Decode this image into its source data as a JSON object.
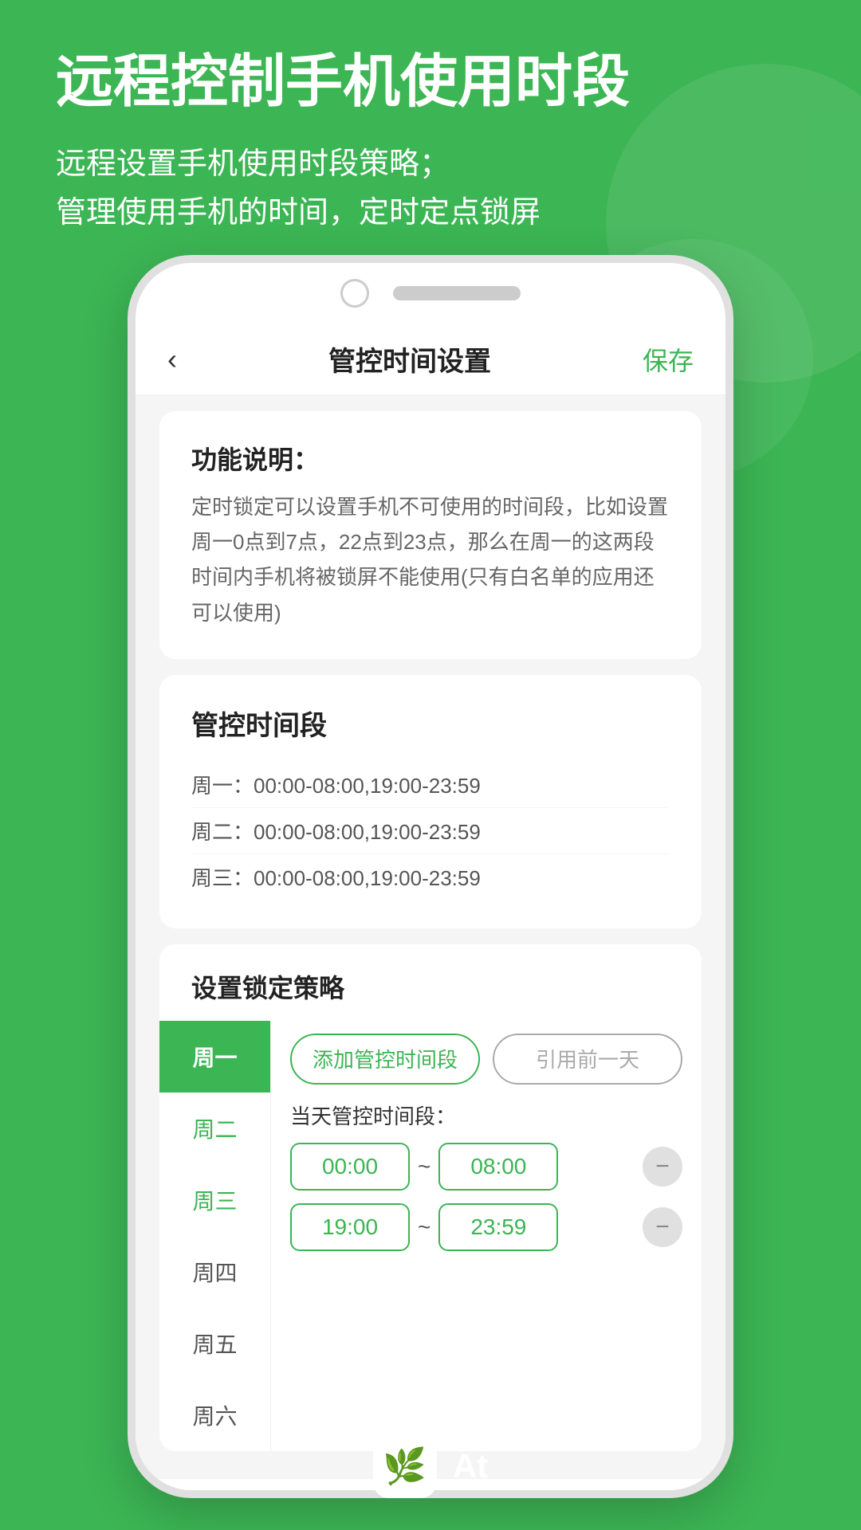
{
  "background": {
    "color": "#3cb554"
  },
  "header": {
    "main_title": "远程控制手机使用时段",
    "sub_line1": "远程设置手机使用时段策略；",
    "sub_line2": "管理使用手机的时间，定时定点锁屏"
  },
  "nav": {
    "back_icon": "‹",
    "title": "管控时间设置",
    "save_label": "保存"
  },
  "feature_card": {
    "title": "功能说明：",
    "desc": "定时锁定可以设置手机不可使用的时间段，比如设置周一0点到7点，22点到23点，那么在周一的这两段时间内手机将被锁屏不能使用(只有白名单的应用还可以使用)"
  },
  "schedule_card": {
    "title": "管控时间段",
    "items": [
      {
        "day": "周一：",
        "times": "00:00-08:00,19:00-23:59"
      },
      {
        "day": "周二：",
        "times": "00:00-08:00,19:00-23:59"
      },
      {
        "day": "周三：",
        "times": "00:00-08:00,19:00-23:59"
      }
    ]
  },
  "strategy_card": {
    "title": "设置锁定策略",
    "days": [
      {
        "label": "周一",
        "state": "active"
      },
      {
        "label": "周二",
        "state": "light"
      },
      {
        "label": "周三",
        "state": "light"
      },
      {
        "label": "周四",
        "state": "normal"
      },
      {
        "label": "周五",
        "state": "normal"
      },
      {
        "label": "周六",
        "state": "normal"
      }
    ],
    "btn_add": "添加管控时间段",
    "btn_copy": "引用前一天",
    "today_label": "当天管控时间段：",
    "time_slots": [
      {
        "start": "00:00",
        "end": "08:00"
      },
      {
        "start": "19:00",
        "end": "23:59"
      }
    ]
  },
  "bottom": {
    "logo_emoji": "🌿",
    "logo_text": "At"
  }
}
